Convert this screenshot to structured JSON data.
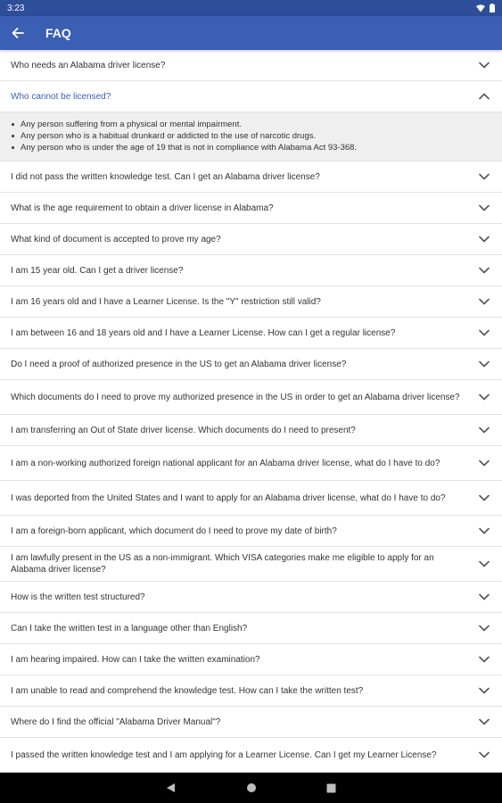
{
  "status": {
    "time": "3:23"
  },
  "header": {
    "title": "FAQ"
  },
  "faq": [
    {
      "q": "Who needs an Alabama driver license?"
    },
    {
      "q": "Who cannot be licensed?",
      "expanded": true,
      "answer": [
        "Any person suffering from a physical or mental impairment.",
        "Any person who is a habitual drunkard or addicted to the use of narcotic drugs.",
        "Any person who is under the age of 19 that is not in compliance with Alabama Act 93-368."
      ]
    },
    {
      "q": "I did not pass the written knowledge test. Can I get an Alabama driver license?"
    },
    {
      "q": "What is the age requirement to obtain a driver license in Alabama?"
    },
    {
      "q": "What kind of document is accepted to prove my age?"
    },
    {
      "q": "I am 15 year old. Can I get a driver license?"
    },
    {
      "q": "I am 16 years old and I have a Learner License. Is the \"Y\" restriction still valid?"
    },
    {
      "q": "I am between 16 and 18 years old and I have a Learner License. How can I get a regular license?"
    },
    {
      "q": "Do I need a proof of authorized presence in the US to get an Alabama driver license?"
    },
    {
      "q": "Which documents do I need to prove my authorized presence in the US in order to get an Alabama driver license?"
    },
    {
      "q": "I am transferring an Out of State driver license. Which documents do I need to present?"
    },
    {
      "q": "I am a non-working authorized foreign national applicant for an Alabama driver license, what do I have to do?"
    },
    {
      "q": "I was deported from the United States and I want to apply for an Alabama driver license, what do I have to do?"
    },
    {
      "q": "I am a foreign-born applicant, which document do I need to prove my date of birth?"
    },
    {
      "q": "I am lawfully present in the US as a non-immigrant. Which VISA categories make me eligible to apply for an Alabama driver license?"
    },
    {
      "q": "How is the written test structured?"
    },
    {
      "q": "Can I take the written test in a language other than English?"
    },
    {
      "q": "I am hearing impaired. How can I take the written examination?"
    },
    {
      "q": "I am unable to read and comprehend the knowledge test. How can I take the written test?"
    },
    {
      "q": "Where do I find the official \"Alabama Driver Manual\"?"
    },
    {
      "q": "I passed the written knowledge test and I am applying for a Learner License. Can I get my Learner License?"
    },
    {
      "q": "I passed the written knowledge test and I am applying for a Learner License. Can I get my Learner License?"
    }
  ],
  "colors": {
    "primary": "#3a5fb3",
    "status_bar": "#2e4e9b",
    "answer_bg": "#efefef"
  }
}
